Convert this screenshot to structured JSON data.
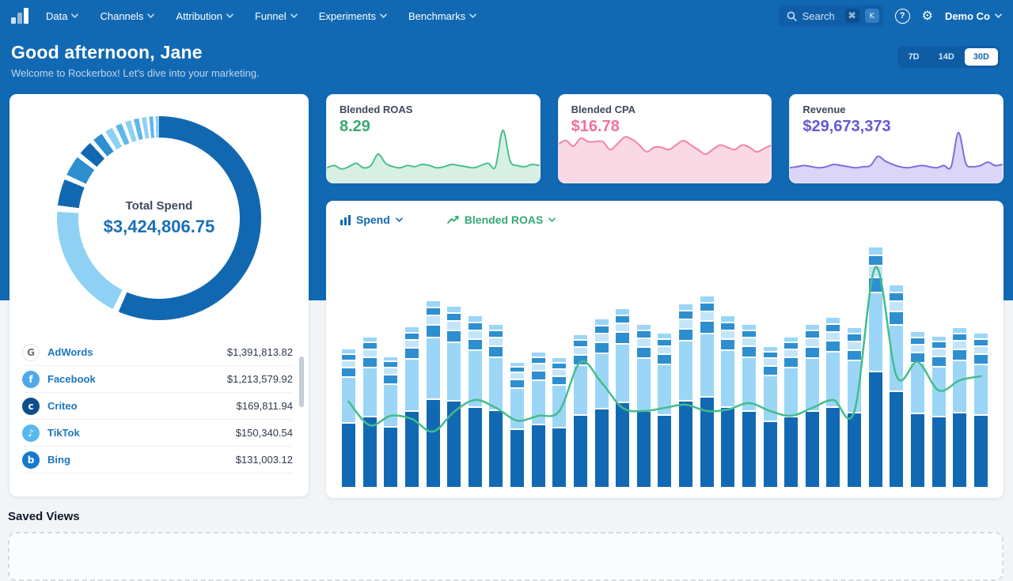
{
  "nav": {
    "items": [
      {
        "label": "Data"
      },
      {
        "label": "Channels"
      },
      {
        "label": "Attribution"
      },
      {
        "label": "Funnel"
      },
      {
        "label": "Experiments"
      },
      {
        "label": "Benchmarks"
      }
    ],
    "search": {
      "placeholder": "Search",
      "shortcut_mod": "⌘",
      "shortcut_key": "K"
    },
    "icons": {
      "help": "?",
      "gear": "⚙"
    },
    "org": "Demo Co"
  },
  "header": {
    "greeting": "Good afternoon, Jane",
    "subtitle": "Welcome to Rockerbox! Let's dive into your marketing.",
    "ranges": [
      "7D",
      "14D",
      "30D"
    ],
    "active_range": "30D"
  },
  "spend_card": {
    "title": "Total Spend",
    "total": "$3,424,806.75",
    "channels": [
      {
        "name": "AdWords",
        "value": "$1,391,813.82",
        "icon": "google-icon",
        "glyph": "G",
        "bg": "#ffffff",
        "fg": "#6a7075",
        "border": "#e1e5ea"
      },
      {
        "name": "Facebook",
        "value": "$1,213,579.92",
        "icon": "facebook-icon",
        "glyph": "f",
        "bg": "#4fa9e8",
        "fg": "#ffffff",
        "border": "transparent"
      },
      {
        "name": "Criteo",
        "value": "$169,811.94",
        "icon": "criteo-icon",
        "glyph": "c",
        "bg": "#0d4e8c",
        "fg": "#ffffff",
        "border": "transparent"
      },
      {
        "name": "TikTok",
        "value": "$150,340.54",
        "icon": "tiktok-icon",
        "glyph": "♪",
        "bg": "#57b9ec",
        "fg": "#ffffff",
        "border": "transparent"
      },
      {
        "name": "Bing",
        "value": "$131,003.12",
        "icon": "bing-icon",
        "glyph": "b",
        "bg": "#1779cd",
        "fg": "#ffffff",
        "border": "transparent"
      }
    ],
    "donut_segments": [
      [
        "#1168b0",
        56.5
      ],
      [
        "#ffffff",
        1
      ],
      [
        "#8ed1f5",
        18.5
      ],
      [
        "#ffffff",
        1
      ],
      [
        "#1168b0",
        4.2
      ],
      [
        "#ffffff",
        0.8
      ],
      [
        "#2e8fd0",
        3.2
      ],
      [
        "#ffffff",
        0.8
      ],
      [
        "#1168b0",
        2.2
      ],
      [
        "#ffffff",
        0.7
      ],
      [
        "#2e8fd0",
        1.6
      ],
      [
        "#ffffff",
        0.7
      ],
      [
        "#8ed1f5",
        1.2
      ],
      [
        "#ffffff",
        0.6
      ],
      [
        "#5fb8ea",
        1.0
      ],
      [
        "#ffffff",
        0.6
      ],
      [
        "#8ed1f5",
        0.9
      ],
      [
        "#ffffff",
        0.5
      ],
      [
        "#5fb8ea",
        0.8
      ],
      [
        "#ffffff",
        0.5
      ],
      [
        "#8ed1f5",
        0.7
      ],
      [
        "#ffffff",
        0.45
      ],
      [
        "#5fb8ea",
        0.6
      ],
      [
        "#ffffff",
        0.4
      ],
      [
        "#8ed1f5",
        0.55
      ]
    ]
  },
  "stat_cards": [
    {
      "title": "Blended ROAS",
      "value": "8.29",
      "color": "#3aa871",
      "line": "#4cbf8d",
      "fill": "#d8f0e3",
      "spark": [
        9,
        11,
        8,
        10,
        13,
        9,
        11,
        21,
        13,
        10,
        9,
        11,
        10,
        12,
        11,
        9,
        10,
        12,
        11,
        10,
        9,
        11,
        13,
        10,
        42,
        15,
        11,
        10,
        12,
        11
      ]
    },
    {
      "title": "Blended CPA",
      "value": "$16.78",
      "color": "#f0709e",
      "line": "#f283ab",
      "fill": "#f9d9e3",
      "spark": [
        30,
        33,
        28,
        35,
        32,
        32,
        32,
        25,
        30,
        36,
        34,
        29,
        23,
        27,
        27,
        25,
        29,
        33,
        29,
        25,
        21,
        25,
        29,
        27,
        25,
        29,
        27,
        23,
        26,
        29
      ]
    },
    {
      "title": "Revenue",
      "value": "$29,673,373",
      "color": "#6558d4",
      "line": "#7c6fe0",
      "fill": "#dbd5f8",
      "spark": [
        9,
        10,
        11,
        10,
        9,
        10,
        12,
        11,
        10,
        9,
        10,
        11,
        19,
        15,
        12,
        10,
        9,
        10,
        11,
        10,
        9,
        11,
        10,
        40,
        13,
        10,
        11,
        14,
        11,
        12
      ]
    }
  ],
  "main_chart": {
    "metric1": {
      "label": "Spend"
    },
    "metric2": {
      "label": "Blended ROAS"
    },
    "palette": {
      "d": "#1269b3",
      "l": "#9bd6f7",
      "m": "#2e8fd0",
      "l2": "#c3e5fa"
    },
    "line_color": "#43bd8b",
    "bars": [
      [
        [
          "d",
          80
        ],
        [
          "l",
          56
        ],
        [
          "m",
          10
        ],
        [
          "l2",
          7
        ],
        [
          "m",
          6
        ],
        [
          "l",
          5
        ]
      ],
      [
        [
          "d",
          88
        ],
        [
          "l",
          60
        ],
        [
          "m",
          11
        ],
        [
          "l2",
          8
        ],
        [
          "m",
          7
        ],
        [
          "l",
          5
        ]
      ],
      [
        [
          "d",
          75
        ],
        [
          "l",
          52
        ],
        [
          "m",
          10
        ],
        [
          "l2",
          7
        ],
        [
          "m",
          6
        ],
        [
          "l",
          4
        ]
      ],
      [
        [
          "d",
          95
        ],
        [
          "l",
          64
        ],
        [
          "m",
          12
        ],
        [
          "l2",
          8
        ],
        [
          "m",
          7
        ],
        [
          "l",
          6
        ]
      ],
      [
        [
          "d",
          110
        ],
        [
          "l",
          76
        ],
        [
          "m",
          14
        ],
        [
          "l2",
          10
        ],
        [
          "m",
          8
        ],
        [
          "l",
          7
        ]
      ],
      [
        [
          "d",
          108
        ],
        [
          "l",
          72
        ],
        [
          "m",
          13
        ],
        [
          "l2",
          10
        ],
        [
          "m",
          8
        ],
        [
          "l",
          7
        ]
      ],
      [
        [
          "d",
          100
        ],
        [
          "l",
          70
        ],
        [
          "m",
          12
        ],
        [
          "l2",
          9
        ],
        [
          "m",
          8
        ],
        [
          "l",
          7
        ]
      ],
      [
        [
          "d",
          96
        ],
        [
          "l",
          65
        ],
        [
          "m",
          12
        ],
        [
          "l2",
          9
        ],
        [
          "m",
          7
        ],
        [
          "l",
          6
        ]
      ],
      [
        [
          "d",
          72
        ],
        [
          "l",
          50
        ],
        [
          "m",
          9
        ],
        [
          "l2",
          7
        ],
        [
          "m",
          5
        ],
        [
          "l",
          4
        ]
      ],
      [
        [
          "d",
          78
        ],
        [
          "l",
          54
        ],
        [
          "m",
          10
        ],
        [
          "l2",
          7
        ],
        [
          "m",
          6
        ],
        [
          "l",
          5
        ]
      ],
      [
        [
          "d",
          74
        ],
        [
          "l",
          52
        ],
        [
          "m",
          9
        ],
        [
          "l2",
          7
        ],
        [
          "m",
          6
        ],
        [
          "l",
          5
        ]
      ],
      [
        [
          "d",
          90
        ],
        [
          "l",
          61
        ],
        [
          "m",
          11
        ],
        [
          "l2",
          8
        ],
        [
          "m",
          7
        ],
        [
          "l",
          5
        ]
      ],
      [
        [
          "d",
          98
        ],
        [
          "l",
          68
        ],
        [
          "m",
          12
        ],
        [
          "l2",
          9
        ],
        [
          "m",
          8
        ],
        [
          "l",
          7
        ]
      ],
      [
        [
          "d",
          106
        ],
        [
          "l",
          72
        ],
        [
          "m",
          13
        ],
        [
          "l2",
          9
        ],
        [
          "m",
          8
        ],
        [
          "l",
          7
        ]
      ],
      [
        [
          "d",
          95
        ],
        [
          "l",
          65
        ],
        [
          "m",
          12
        ],
        [
          "l2",
          9
        ],
        [
          "m",
          8
        ],
        [
          "l",
          6
        ]
      ],
      [
        [
          "d",
          90
        ],
        [
          "l",
          62
        ],
        [
          "m",
          11
        ],
        [
          "l2",
          8
        ],
        [
          "m",
          7
        ],
        [
          "l",
          6
        ]
      ],
      [
        [
          "d",
          108
        ],
        [
          "l",
          74
        ],
        [
          "m",
          13
        ],
        [
          "l2",
          10
        ],
        [
          "m",
          9
        ],
        [
          "l",
          7
        ]
      ],
      [
        [
          "d",
          113
        ],
        [
          "l",
          78
        ],
        [
          "m",
          14
        ],
        [
          "l2",
          10
        ],
        [
          "m",
          9
        ],
        [
          "l",
          7
        ]
      ],
      [
        [
          "d",
          100
        ],
        [
          "l",
          70
        ],
        [
          "m",
          12
        ],
        [
          "l2",
          9
        ],
        [
          "m",
          8
        ],
        [
          "l",
          7
        ]
      ],
      [
        [
          "d",
          95
        ],
        [
          "l",
          66
        ],
        [
          "m",
          12
        ],
        [
          "l2",
          9
        ],
        [
          "m",
          7
        ],
        [
          "l",
          6
        ]
      ],
      [
        [
          "d",
          82
        ],
        [
          "l",
          56
        ],
        [
          "m",
          10
        ],
        [
          "l2",
          8
        ],
        [
          "m",
          6
        ],
        [
          "l",
          5
        ]
      ],
      [
        [
          "d",
          88
        ],
        [
          "l",
          60
        ],
        [
          "m",
          11
        ],
        [
          "l2",
          8
        ],
        [
          "m",
          7
        ],
        [
          "l",
          5
        ]
      ],
      [
        [
          "d",
          95
        ],
        [
          "l",
          65
        ],
        [
          "m",
          12
        ],
        [
          "l2",
          9
        ],
        [
          "m",
          8
        ],
        [
          "l",
          6
        ]
      ],
      [
        [
          "d",
          100
        ],
        [
          "l",
          68
        ],
        [
          "m",
          12
        ],
        [
          "l2",
          9
        ],
        [
          "m",
          8
        ],
        [
          "l",
          7
        ]
      ],
      [
        [
          "d",
          93
        ],
        [
          "l",
          64
        ],
        [
          "m",
          11
        ],
        [
          "l2",
          9
        ],
        [
          "m",
          8
        ],
        [
          "l",
          6
        ]
      ],
      [
        [
          "d",
          145
        ],
        [
          "l",
          98
        ],
        [
          "m",
          17
        ],
        [
          "l2",
          13
        ],
        [
          "m",
          11
        ],
        [
          "l",
          9
        ]
      ],
      [
        [
          "d",
          120
        ],
        [
          "l",
          82
        ],
        [
          "m",
          15
        ],
        [
          "l2",
          11
        ],
        [
          "m",
          9
        ],
        [
          "l",
          8
        ]
      ],
      [
        [
          "d",
          92
        ],
        [
          "l",
          62
        ],
        [
          "m",
          11
        ],
        [
          "l2",
          8
        ],
        [
          "m",
          7
        ],
        [
          "l",
          6
        ]
      ],
      [
        [
          "d",
          88
        ],
        [
          "l",
          61
        ],
        [
          "m",
          11
        ],
        [
          "l2",
          8
        ],
        [
          "m",
          7
        ],
        [
          "l",
          5
        ]
      ],
      [
        [
          "d",
          93
        ],
        [
          "l",
          64
        ],
        [
          "m",
          12
        ],
        [
          "l2",
          9
        ],
        [
          "m",
          7
        ],
        [
          "l",
          6
        ]
      ],
      [
        [
          "d",
          90
        ],
        [
          "l",
          62
        ],
        [
          "m",
          11
        ],
        [
          "l2",
          8
        ],
        [
          "m",
          7
        ],
        [
          "l",
          6
        ]
      ]
    ],
    "roas_line": [
      108,
      78,
      90,
      86,
      70,
      95,
      110,
      100,
      84,
      90,
      96,
      158,
      132,
      100,
      96,
      100,
      104,
      96,
      98,
      106,
      96,
      90,
      100,
      110,
      96,
      278,
      140,
      158,
      122,
      135,
      140
    ]
  },
  "saved_views": {
    "title": "Saved Views"
  }
}
